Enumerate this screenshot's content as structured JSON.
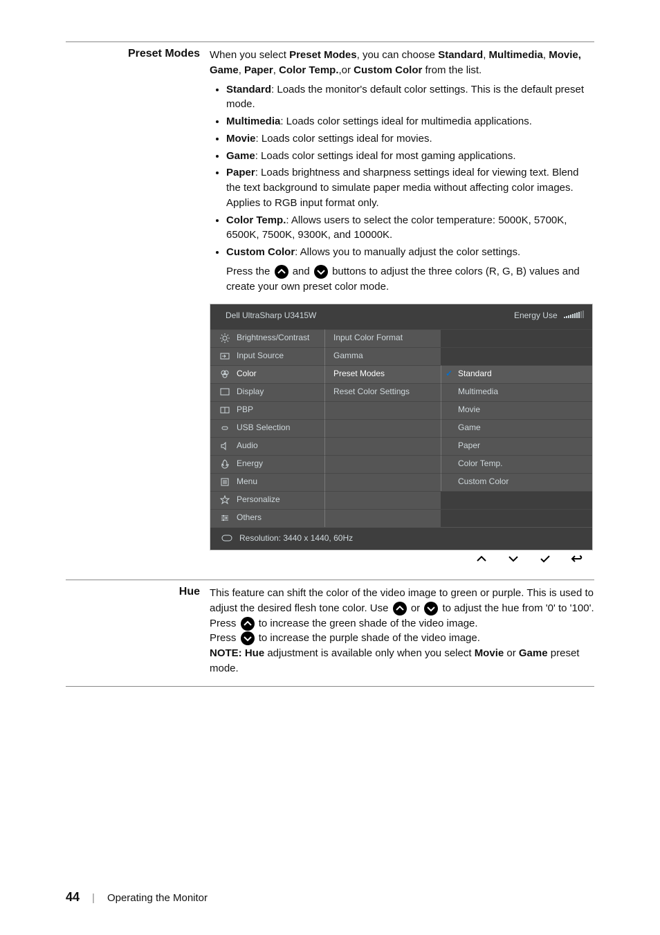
{
  "preset_modes": {
    "title": "Preset Modes",
    "intro_a": "When you select ",
    "intro_b": "Preset Modes",
    "intro_c": ", you can choose ",
    "intro_d": "Standard",
    "intro_e": ", ",
    "intro_f": "Multimedia",
    "intro_g": ", ",
    "intro_h": "Movie, Game",
    "intro_i": ", ",
    "intro_j": "Paper",
    "intro_k": ", ",
    "intro_l": "Color Temp.",
    "intro_m": ",or ",
    "intro_n": "Custom Color",
    "intro_o": " from the list.",
    "items": [
      {
        "name": "Standard",
        "desc": ": Loads the monitor's default color settings. This is the default preset mode."
      },
      {
        "name": "Multimedia",
        "desc": ": Loads color settings ideal for multimedia applications."
      },
      {
        "name": "Movie",
        "desc": ": Loads color settings ideal for movies."
      },
      {
        "name": "Game",
        "desc": ": Loads color settings ideal for most gaming applications."
      },
      {
        "name": "Paper",
        "desc": ": Loads brightness and sharpness settings ideal for viewing text. Blend the text background to simulate paper media without affecting color images. Applies to RGB input format only."
      },
      {
        "name": "Color Temp.",
        "desc": ": Allows users to select the color temperature: 5000K, 5700K, 6500K, 7500K, 9300K, and 10000K."
      },
      {
        "name": "Custom Color",
        "desc": ": Allows you to manually adjust the color settings."
      }
    ],
    "press_a": "Press the ",
    "press_b": " and ",
    "press_c": " buttons to adjust the three colors (R, G, B) values and create your own preset color mode."
  },
  "osd": {
    "title": "Dell UltraSharp U3415W",
    "energy": "Energy Use",
    "left": [
      "Brightness/Contrast",
      "Input Source",
      "Color",
      "Display",
      "PBP",
      "USB Selection",
      "Audio",
      "Energy",
      "Menu",
      "Personalize",
      "Others"
    ],
    "mid": [
      "Input Color Format",
      "Gamma",
      "Preset Modes",
      "Reset Color Settings"
    ],
    "opts": [
      "Standard",
      "Multimedia",
      "Movie",
      "Game",
      "Paper",
      "Color Temp.",
      "Custom Color"
    ],
    "resolution": "Resolution: 3440 x 1440, 60Hz"
  },
  "hue": {
    "title": "Hue",
    "line1a": "This feature can shift the color of the video image to green or purple. This is used to adjust the desired flesh tone color. Use ",
    "line1b": " or ",
    "line1c": " to adjust the hue from '0' to '100'.",
    "line2a": "Press ",
    "line2b": " to increase the green shade of the video image.",
    "line3a": "Press ",
    "line3b": " to increase the purple shade of the video image.",
    "noteA": "NOTE: Hue",
    "noteB": " adjustment is available only when you select ",
    "noteC": "Movie",
    "noteD": " or ",
    "noteE": "Game",
    "noteF": " preset mode."
  },
  "footer": {
    "page": "44",
    "section": "Operating the Monitor"
  }
}
